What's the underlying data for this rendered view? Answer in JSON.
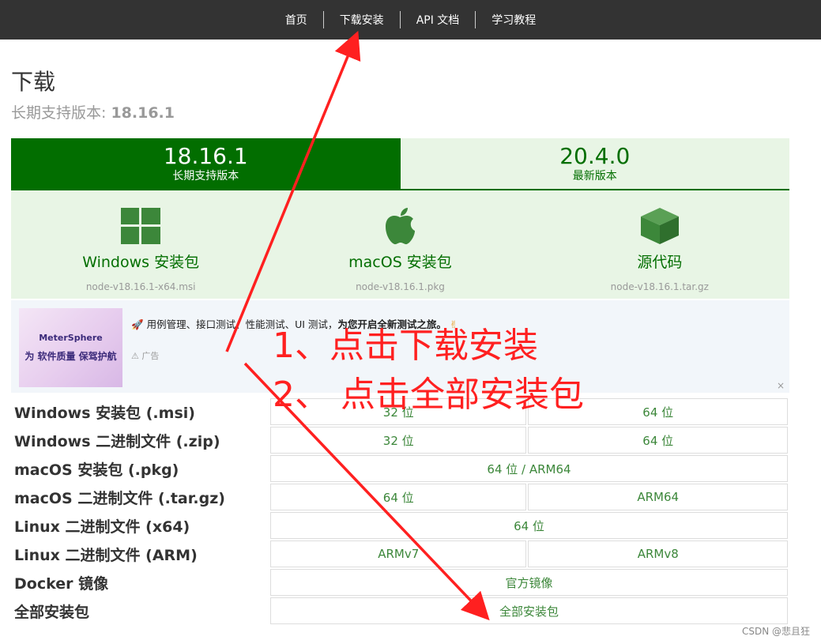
{
  "nav": {
    "items": [
      "首页",
      "下载安装",
      "API 文档",
      "学习教程"
    ]
  },
  "page": {
    "title": "下载",
    "lts_prefix": "长期支持版本: ",
    "lts_version": "18.16.1"
  },
  "version_tabs": [
    {
      "version": "18.16.1",
      "label": "长期支持版本"
    },
    {
      "version": "20.4.0",
      "label": "最新版本"
    }
  ],
  "installers": [
    {
      "icon": "windows-icon",
      "label": "Windows 安装包",
      "file": "node-v18.16.1-x64.msi"
    },
    {
      "icon": "apple-icon",
      "label": "macOS 安装包",
      "file": "node-v18.16.1.pkg"
    },
    {
      "icon": "source-box-icon",
      "label": "源代码",
      "file": "node-v18.16.1.tar.gz"
    }
  ],
  "ad": {
    "brand": "MeterSphere",
    "slogan": "为 软件质量 保驾护航",
    "text_plain": "用例管理、接口测试、性能测试、UI 测试，",
    "text_bold": "为您开启全新测试之旅。",
    "tag": "广告",
    "close": "×"
  },
  "downloads": [
    {
      "label": "Windows 安装包 (.msi)",
      "cells": [
        "32 位",
        "64 位"
      ]
    },
    {
      "label": "Windows 二进制文件 (.zip)",
      "cells": [
        "32 位",
        "64 位"
      ]
    },
    {
      "label": "macOS 安装包 (.pkg)",
      "cells": [
        "64 位 / ARM64"
      ]
    },
    {
      "label": "macOS 二进制文件 (.tar.gz)",
      "cells": [
        "64 位",
        "ARM64"
      ]
    },
    {
      "label": "Linux 二进制文件 (x64)",
      "cells": [
        "64 位"
      ]
    },
    {
      "label": "Linux 二进制文件 (ARM)",
      "cells": [
        "ARMv7",
        "ARMv8"
      ]
    },
    {
      "label": "Docker 镜像",
      "cells": [
        "官方镜像"
      ]
    },
    {
      "label": "全部安装包",
      "cells": [
        "全部安装包"
      ]
    }
  ],
  "annotations": {
    "step1": "1、点击下载安装",
    "step2": "2、 点击全部安装包"
  },
  "watermark": "CSDN @悲且狂",
  "colors": {
    "nav_bg": "#333333",
    "brand_green": "#026e00",
    "light_green": "#e8f5e5",
    "link_green": "#3c873a",
    "annotation_red": "#ff2020"
  }
}
